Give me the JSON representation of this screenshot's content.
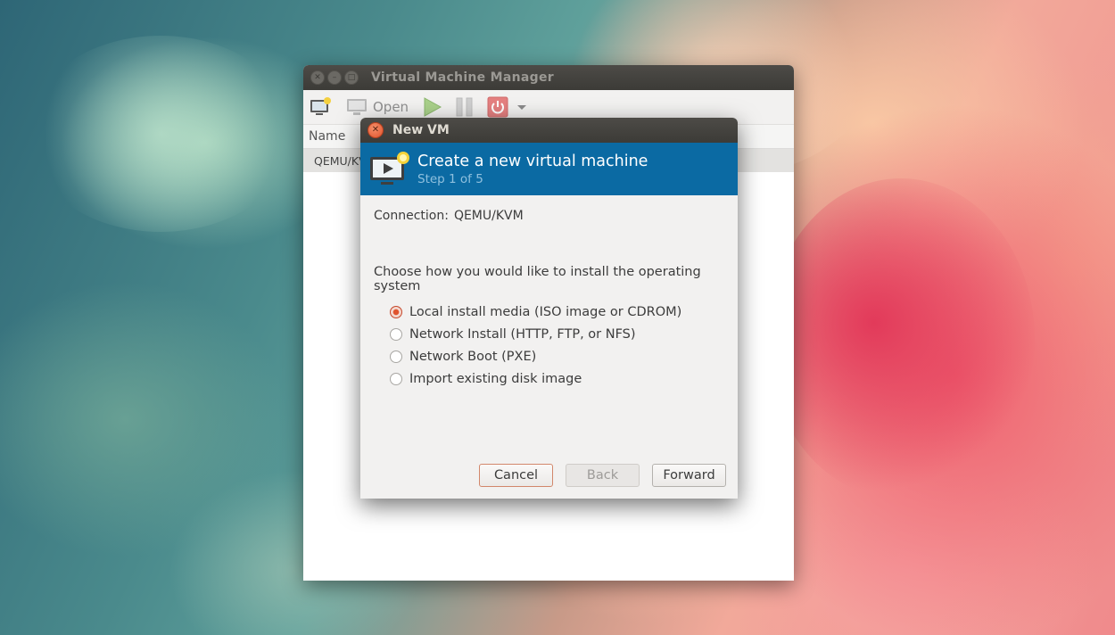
{
  "main_window": {
    "title": "Virtual Machine Manager",
    "window_buttons": [
      "close",
      "minimize",
      "maximize"
    ],
    "toolbar": {
      "items": [
        "new-vm-icon",
        "monitor-icon",
        "play-icon",
        "pause-icon",
        "power-icon",
        "dropdown-arrow-icon"
      ],
      "open_label": "Open"
    },
    "column_header": "Name",
    "connection_row": "QEMU/KVM"
  },
  "dialog": {
    "title": "New VM",
    "banner": {
      "icon": "new-vm-icon",
      "title": "Create a new virtual machine",
      "step": "Step 1 of 5"
    },
    "connection": {
      "label": "Connection:",
      "value": "QEMU/KVM"
    },
    "prompt": "Choose how you would like to install the operating system",
    "options": [
      {
        "label": "Local install media (ISO image or CDROM)",
        "selected": true
      },
      {
        "label": "Network Install (HTTP, FTP, or NFS)",
        "selected": false
      },
      {
        "label": "Network Boot (PXE)",
        "selected": false
      },
      {
        "label": "Import existing disk image",
        "selected": false
      }
    ],
    "buttons": {
      "cancel": "Cancel",
      "back": "Back",
      "forward": "Forward"
    }
  },
  "colors": {
    "banner": "#0b6aa3",
    "titlebar": "#3c3b37",
    "accent": "#e0532d",
    "dialog_bg": "#f2f1f0"
  }
}
